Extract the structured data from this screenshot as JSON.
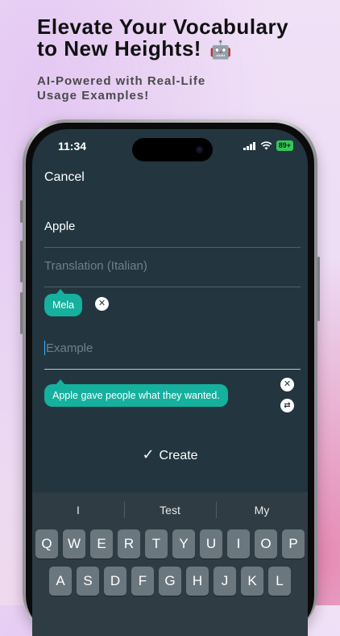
{
  "promo": {
    "headline_line1": "Elevate Your Vocabulary",
    "headline_line2": "to New Heights!",
    "headline_emoji": "🤖",
    "subhead_line1": "AI-Powered with Real-Life",
    "subhead_line2": "Usage Examples!"
  },
  "status_bar": {
    "time": "11:34",
    "battery": "89+"
  },
  "nav": {
    "cancel_label": "Cancel"
  },
  "form": {
    "word_value": "Apple",
    "translation_placeholder": "Translation (Italian)",
    "translation_suggestion": "Mela",
    "example_placeholder": "Example",
    "example_suggestion": "Apple gave people what they wanted.",
    "create_label": "Create"
  },
  "keyboard": {
    "suggestions": [
      "I",
      "Test",
      "My"
    ],
    "row1": [
      "Q",
      "W",
      "E",
      "R",
      "T",
      "Y",
      "U",
      "I",
      "O",
      "P"
    ],
    "row2": [
      "A",
      "S",
      "D",
      "F",
      "G",
      "H",
      "J",
      "K",
      "L"
    ]
  },
  "icons": {
    "dismiss": "close-icon",
    "swap": "swap-icon",
    "check": "checkmark-icon",
    "signal": "signal-icon",
    "wifi": "wifi-icon"
  },
  "colors": {
    "screen_bg": "#23363f",
    "accent": "#15b09e",
    "battery": "#34c759"
  }
}
